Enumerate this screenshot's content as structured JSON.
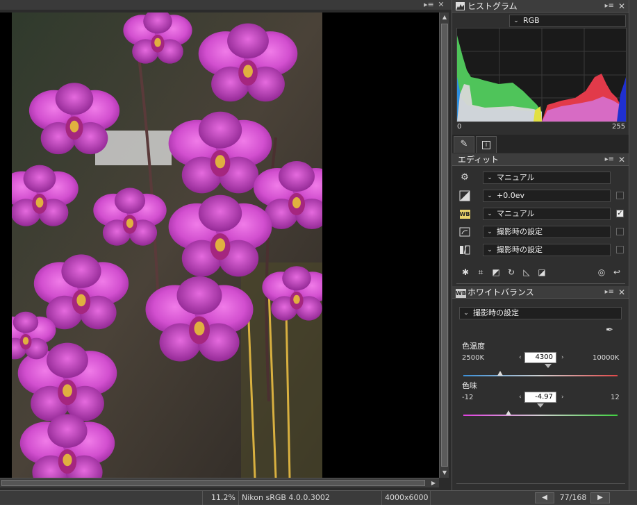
{
  "histogram": {
    "title": "ヒストグラム",
    "channel": "RGB",
    "min_label": "0",
    "max_label": "255"
  },
  "tabs": {
    "edit_icon": "pencil-icon",
    "info_icon": "info-icon"
  },
  "edit": {
    "title": "エディット",
    "rows": [
      {
        "icon": "gear-icon",
        "value": "マニュアル",
        "checked": null
      },
      {
        "icon": "exposure-icon",
        "value": "+0.0ev",
        "checked": false
      },
      {
        "icon": "wb-icon",
        "value": "マニュアル",
        "checked": true
      },
      {
        "icon": "picture-control-icon",
        "value": "撮影時の設定",
        "checked": false
      },
      {
        "icon": "d-lighting-icon",
        "value": "撮影時の設定",
        "checked": false
      }
    ]
  },
  "white_balance": {
    "title": "ホワイトバランス",
    "badge": "WB",
    "preset": "撮影時の設定",
    "temperature": {
      "label": "色温度",
      "min": "2500K",
      "max": "10000K",
      "value": "4300",
      "numeric": 4300,
      "range": [
        2500,
        10000
      ]
    },
    "tint": {
      "label": "色味",
      "min": "-12",
      "max": "12",
      "value": "-4.97",
      "numeric": -4.97,
      "range": [
        -12,
        12
      ]
    }
  },
  "status": {
    "zoom": "11.2%",
    "profile": "Nikon sRGB 4.0.0.3002",
    "dimensions": "4000x6000",
    "position": "77/168",
    "prev": "◀",
    "next": "▶"
  },
  "colors": {
    "accent_wb": "#e9d36a",
    "tint_start": "#e040e0",
    "tint_end": "#40d040",
    "temp_start": "#3a8fd8",
    "temp_end": "#e04848"
  }
}
